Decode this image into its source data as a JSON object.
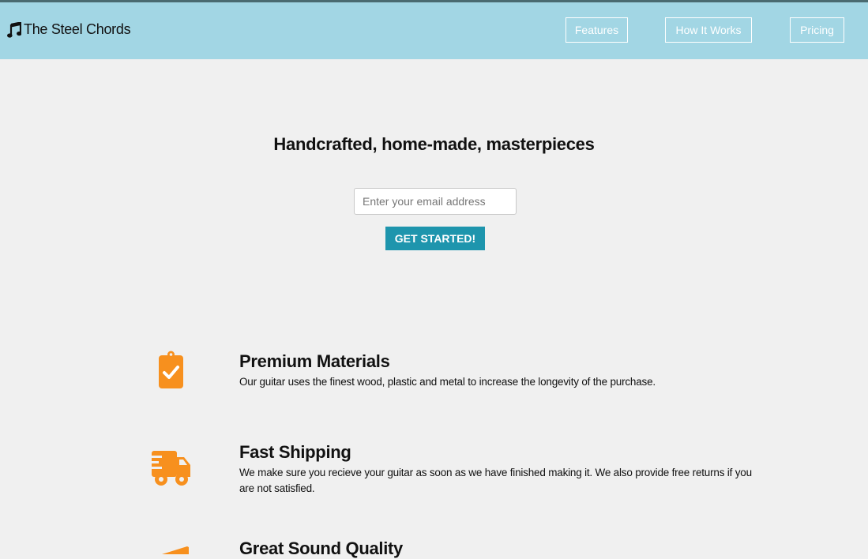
{
  "header": {
    "brand": "The Steel Chords",
    "brand_icon": "music-note-icon",
    "nav": {
      "features": "Features",
      "how_it_works": "How It Works",
      "pricing": "Pricing"
    }
  },
  "hero": {
    "title": "Handcrafted, home-made, masterpieces",
    "email_placeholder": "Enter your email address",
    "cta_label": "GET STARTED!"
  },
  "features": [
    {
      "icon": "clipboard-check-icon",
      "title": "Premium Materials",
      "description": "Our guitar uses the finest wood, plastic and metal to increase the longevity of the purchase."
    },
    {
      "icon": "shipping-truck-icon",
      "title": "Fast Shipping",
      "description": "We make sure you recieve your guitar as soon as we have finished making it. We also provide free returns if you are not satisfied."
    },
    {
      "icon": "megaphone-icon",
      "title": "Great Sound Quality",
      "description": ""
    }
  ],
  "colors": {
    "header_bg": "#a2d6e4",
    "page_bg": "#f0f0f0",
    "accent_button": "#1e95ad",
    "icon_orange": "#f7901e"
  }
}
